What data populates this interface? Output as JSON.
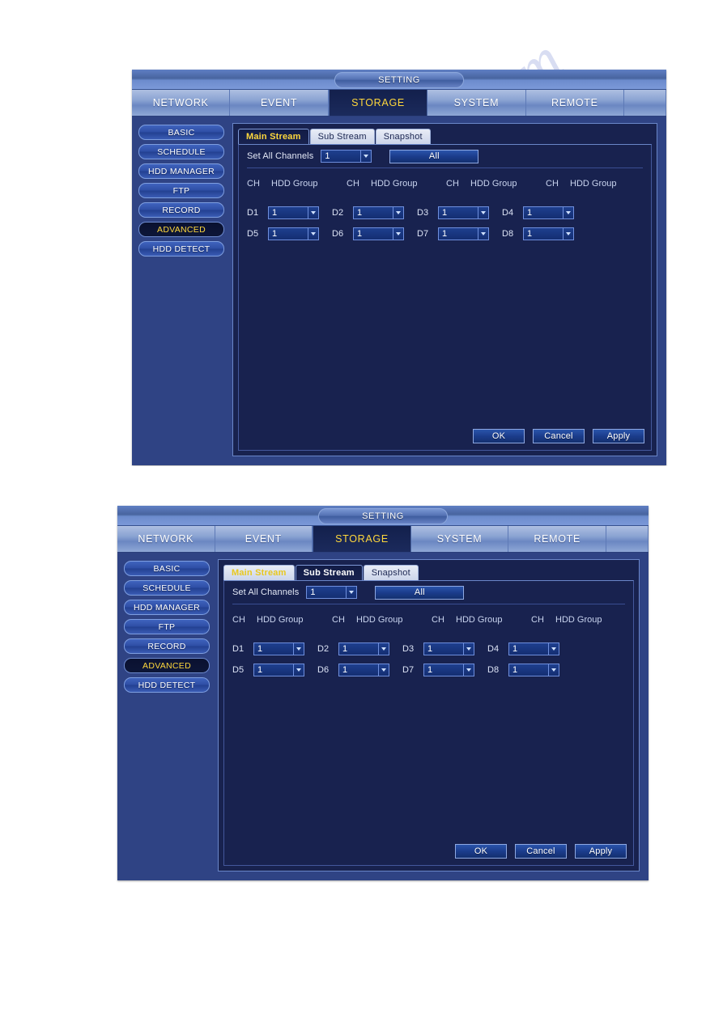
{
  "watermark": "manualsarchive.com",
  "window_title": "SETTING",
  "top_tabs": [
    "NETWORK",
    "EVENT",
    "STORAGE",
    "SYSTEM",
    "REMOTE"
  ],
  "top_tab_active": "STORAGE",
  "sidebar": {
    "items": [
      "BASIC",
      "SCHEDULE",
      "HDD MANAGER",
      "FTP",
      "RECORD",
      "ADVANCED",
      "HDD DETECT"
    ],
    "active": "ADVANCED"
  },
  "sub_tabs": [
    "Main Stream",
    "Sub Stream",
    "Snapshot"
  ],
  "set_all": {
    "label": "Set All Channels",
    "value": "1",
    "all_button": "All"
  },
  "table": {
    "headers": [
      "CH",
      "HDD Group",
      "CH",
      "HDD Group",
      "CH",
      "HDD Group",
      "CH",
      "HDD Group"
    ],
    "header_ch": "CH",
    "header_group": "HDD Group",
    "rows": [
      {
        "cells": [
          {
            "ch": "D1",
            "group": "1"
          },
          {
            "ch": "D2",
            "group": "1"
          },
          {
            "ch": "D3",
            "group": "1"
          },
          {
            "ch": "D4",
            "group": "1"
          }
        ]
      },
      {
        "cells": [
          {
            "ch": "D5",
            "group": "1"
          },
          {
            "ch": "D6",
            "group": "1"
          },
          {
            "ch": "D7",
            "group": "1"
          },
          {
            "ch": "D8",
            "group": "1"
          }
        ]
      }
    ]
  },
  "footer": {
    "ok": "OK",
    "cancel": "Cancel",
    "apply": "Apply"
  },
  "panel_1": {
    "active_sub_tab": "Main Stream"
  },
  "panel_2": {
    "active_sub_tab": "Sub Stream"
  },
  "colors": {
    "frame_blue": "#2f4384",
    "content_navy": "#18224f",
    "accent_yellow": "#ffd83c",
    "select_blue": "#1e3f8e",
    "border_light": "#6a86c8"
  }
}
